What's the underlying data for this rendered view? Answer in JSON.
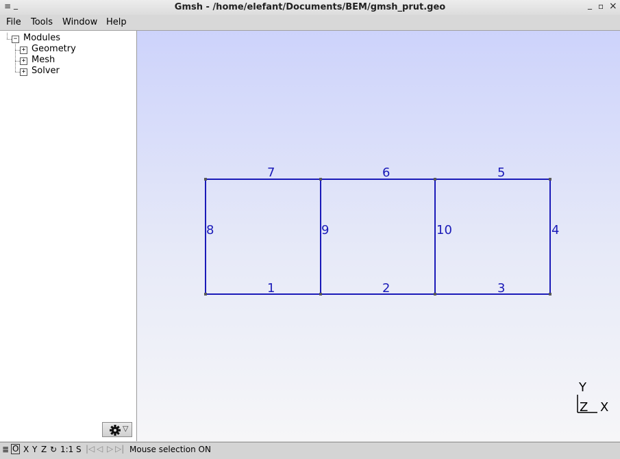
{
  "window": {
    "title": "Gmsh - /home/elefant/Documents/BEM/gmsh_prut.geo",
    "menu_icon": "≡",
    "minimize": "_",
    "maximize": "▫",
    "close": "×"
  },
  "menubar": {
    "items": [
      "File",
      "Tools",
      "Window",
      "Help"
    ]
  },
  "tree": {
    "root": {
      "label": "Modules",
      "toggle": "−"
    },
    "children": [
      {
        "label": "Geometry",
        "toggle": "+"
      },
      {
        "label": "Mesh",
        "toggle": "+"
      },
      {
        "label": "Solver",
        "toggle": "+"
      }
    ]
  },
  "gear_button": {
    "icon": "gear-icon",
    "arrow": "▽"
  },
  "geometry": {
    "line_color": "#1a1ab8",
    "point_color": "#5a5a5a",
    "line_labels": [
      "1",
      "2",
      "3",
      "4",
      "5",
      "6",
      "7",
      "8",
      "9",
      "10"
    ]
  },
  "axes": {
    "y": "Y",
    "z": "Z",
    "x": "X"
  },
  "statusbar": {
    "menu_icon": "≣",
    "ortho": "O",
    "x": "X",
    "y": "Y",
    "z": "Z",
    "rotate_icon": "↻",
    "scale": "1:1",
    "s": "S",
    "message": "Mouse selection ON"
  }
}
